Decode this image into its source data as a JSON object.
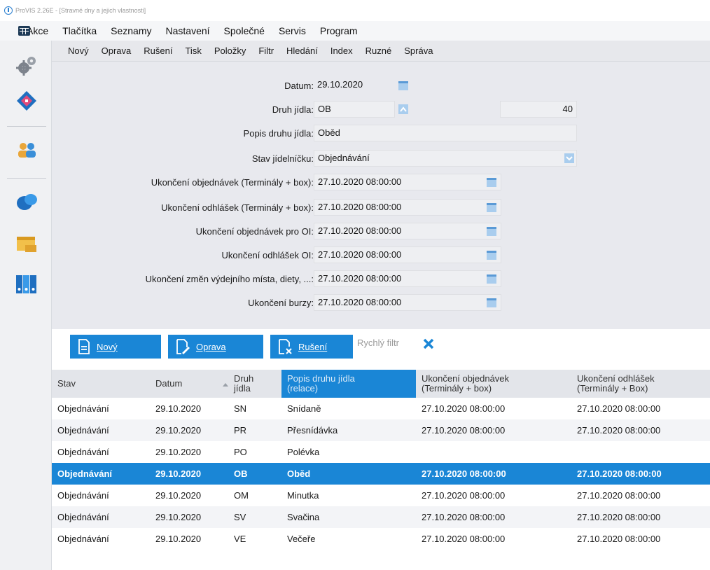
{
  "window": {
    "title": "ProVIS 2.26E - [Stravné dny a jejich vlastnosti]"
  },
  "menubar": {
    "items": [
      "Akce",
      "Tlačítka",
      "Seznamy",
      "Nastavení",
      "Společné",
      "Servis",
      "Program"
    ]
  },
  "toolbar": {
    "items": [
      "Nový",
      "Oprava",
      "Rušení",
      "Tisk",
      "Položky",
      "Filtr",
      "Hledání",
      "Index",
      "Ruzné",
      "Správa"
    ]
  },
  "form": {
    "datum": {
      "label": "Datum:",
      "value": "29.10.2020"
    },
    "druh_jidla": {
      "label": "Druh jídla:",
      "value": "OB",
      "extra_value": "40"
    },
    "popis": {
      "label": "Popis druhu jídla:",
      "value": "Oběd"
    },
    "stav": {
      "label": "Stav jídelníčku:",
      "value": "Objednávání"
    },
    "deadlines": [
      {
        "label": "Ukončení objednávek (Terminály + box):",
        "value": "27.10.2020 08:00:00"
      },
      {
        "label": "Ukončení odhlášek (Terminály + box):",
        "value": "27.10.2020 08:00:00"
      },
      {
        "label": "Ukončení objednávek pro OI:",
        "value": "27.10.2020 08:00:00"
      },
      {
        "label": "Ukončení odhlášek OI:",
        "value": "27.10.2020 08:00:00"
      },
      {
        "label": "Ukončení změn výdejního místa, diety, ...:",
        "value": "27.10.2020 08:00:00"
      },
      {
        "label": "Ukončení burzy:",
        "value": "27.10.2020 08:00:00"
      }
    ]
  },
  "actions": {
    "new_label": "Nový",
    "edit_label": "Oprava",
    "delete_label": "Rušení",
    "quick_filter_placeholder": "Rychlý filtr"
  },
  "table": {
    "columns": [
      "Stav",
      "Datum",
      "Druh jídla",
      "Popis druhu jídla (relace)",
      "Ukončení objednávek (Terminály + box)",
      "Ukončení odhlášek (Terminály + Box)"
    ],
    "rows": [
      [
        "Objednávání",
        "29.10.2020",
        "SN",
        "Snídaně",
        "27.10.2020 08:00:00",
        "27.10.2020 08:00:00"
      ],
      [
        "Objednávání",
        "29.10.2020",
        "PR",
        "Přesnídávka",
        "27.10.2020 08:00:00",
        "27.10.2020 08:00:00"
      ],
      [
        "Objednávání",
        "29.10.2020",
        "PO",
        "Polévka",
        "",
        ""
      ],
      [
        "Objednávání",
        "29.10.2020",
        "OB",
        "Oběd",
        "27.10.2020 08:00:00",
        "27.10.2020 08:00:00"
      ],
      [
        "Objednávání",
        "29.10.2020",
        "OM",
        "Minutka",
        "27.10.2020 08:00:00",
        "27.10.2020 08:00:00"
      ],
      [
        "Objednávání",
        "29.10.2020",
        "SV",
        "Svačina",
        "27.10.2020 08:00:00",
        "27.10.2020 08:00:00"
      ],
      [
        "Objednávání",
        "29.10.2020",
        "VE",
        "Večeře",
        "27.10.2020 08:00:00",
        "27.10.2020 08:00:00"
      ]
    ],
    "selected_row": 3
  },
  "colors": {
    "accent": "#1a86d6",
    "form_bg": "#e8e9ee",
    "header_bg": "#e3e5ea"
  }
}
